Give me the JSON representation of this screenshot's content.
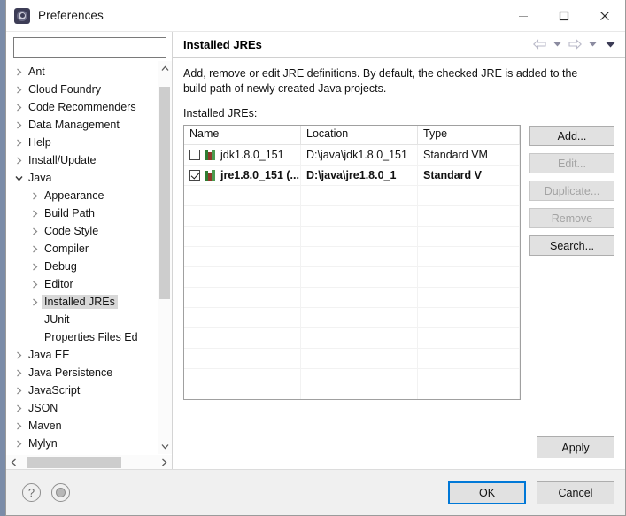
{
  "window": {
    "title": "Preferences",
    "icon": "preferences-gear-icon",
    "controls": {
      "minimize": "minimize-icon",
      "maximize": "maximize-icon",
      "close": "close-icon"
    }
  },
  "sidebar": {
    "filter": {
      "value": "",
      "placeholder": ""
    },
    "tree": [
      {
        "label": "Ant",
        "level": 0,
        "twisty": "collapsed",
        "selected": false
      },
      {
        "label": "Cloud Foundry",
        "level": 0,
        "twisty": "collapsed",
        "selected": false
      },
      {
        "label": "Code Recommenders",
        "level": 0,
        "twisty": "collapsed",
        "selected": false
      },
      {
        "label": "Data Management",
        "level": 0,
        "twisty": "collapsed",
        "selected": false
      },
      {
        "label": "Help",
        "level": 0,
        "twisty": "collapsed",
        "selected": false
      },
      {
        "label": "Install/Update",
        "level": 0,
        "twisty": "collapsed",
        "selected": false
      },
      {
        "label": "Java",
        "level": 0,
        "twisty": "expanded",
        "selected": false
      },
      {
        "label": "Appearance",
        "level": 1,
        "twisty": "collapsed",
        "selected": false
      },
      {
        "label": "Build Path",
        "level": 1,
        "twisty": "collapsed",
        "selected": false
      },
      {
        "label": "Code Style",
        "level": 1,
        "twisty": "collapsed",
        "selected": false
      },
      {
        "label": "Compiler",
        "level": 1,
        "twisty": "collapsed",
        "selected": false
      },
      {
        "label": "Debug",
        "level": 1,
        "twisty": "collapsed",
        "selected": false
      },
      {
        "label": "Editor",
        "level": 1,
        "twisty": "collapsed",
        "selected": false
      },
      {
        "label": "Installed JREs",
        "level": 1,
        "twisty": "collapsed",
        "selected": true
      },
      {
        "label": "JUnit",
        "level": 1,
        "twisty": "none",
        "selected": false
      },
      {
        "label": "Properties Files Ed",
        "level": 1,
        "twisty": "none",
        "selected": false
      },
      {
        "label": "Java EE",
        "level": 0,
        "twisty": "collapsed",
        "selected": false
      },
      {
        "label": "Java Persistence",
        "level": 0,
        "twisty": "collapsed",
        "selected": false
      },
      {
        "label": "JavaScript",
        "level": 0,
        "twisty": "collapsed",
        "selected": false
      },
      {
        "label": "JSON",
        "level": 0,
        "twisty": "collapsed",
        "selected": false
      },
      {
        "label": "Maven",
        "level": 0,
        "twisty": "collapsed",
        "selected": false
      },
      {
        "label": "Mylyn",
        "level": 0,
        "twisty": "collapsed",
        "selected": false
      }
    ],
    "scrollbars": {
      "vertical_up": "scroll-up-icon",
      "vertical_down": "scroll-down-icon",
      "horizontal_left": "scroll-left-icon",
      "horizontal_right": "scroll-right-icon"
    }
  },
  "page": {
    "title": "Installed JREs",
    "nav": {
      "back": "back-arrow-icon",
      "back_menu": "chevron-down-icon",
      "forward": "forward-arrow-icon",
      "forward_menu": "chevron-down-icon",
      "view_menu": "chevron-down-filled-icon"
    },
    "description": "Add, remove or edit JRE definitions. By default, the checked JRE is added to the build path of newly created Java projects.",
    "list_label": "Installed JREs:",
    "table": {
      "columns": [
        "Name",
        "Location",
        "Type",
        ""
      ],
      "rows": [
        {
          "checked": false,
          "bold": false,
          "name": "jdk1.8.0_151",
          "location": "D:\\java\\jdk1.8.0_151",
          "type": "Standard VM",
          "extra": ""
        },
        {
          "checked": true,
          "bold": true,
          "name": "jre1.8.0_151 (...",
          "location": "D:\\java\\jre1.8.0_1",
          "type": "Standard V",
          "extra": ""
        }
      ],
      "empty_row_count": 11
    },
    "side_buttons": [
      {
        "label": "Add...",
        "enabled": true
      },
      {
        "label": "Edit...",
        "enabled": false
      },
      {
        "label": "Duplicate...",
        "enabled": false
      },
      {
        "label": "Remove",
        "enabled": false
      },
      {
        "label": "Search...",
        "enabled": true
      }
    ],
    "apply_label": "Apply"
  },
  "footer": {
    "help_icon": "help-question-icon",
    "globe_icon": "globe-icon",
    "buttons": [
      {
        "label": "OK",
        "default": true
      },
      {
        "label": "Cancel",
        "default": false
      }
    ]
  },
  "colors": {
    "accent": "#0078d7",
    "dialog_bg": "#f0f0f0",
    "desktop_bg": "#7b8ca8",
    "selection": "#d8d8d8"
  }
}
